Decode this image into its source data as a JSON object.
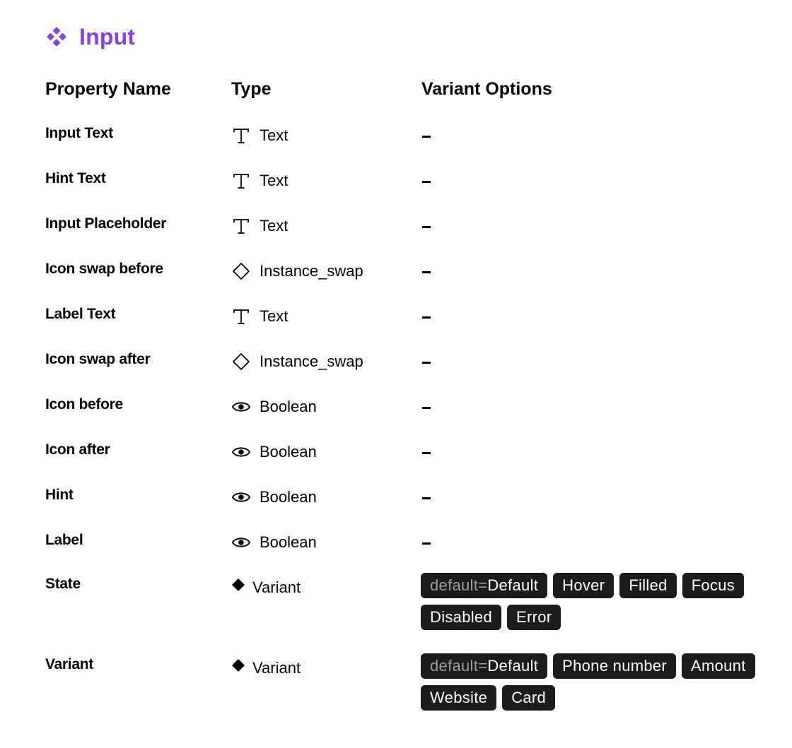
{
  "component": {
    "title": "Input",
    "icon": "component-icon",
    "accent_color": "#8a3ee8"
  },
  "headers": {
    "property_name": "Property Name",
    "type": "Type",
    "variant_options": "Variant Options"
  },
  "properties": [
    {
      "name": "Input Text",
      "type": "Text",
      "type_icon": "text-icon",
      "options_placeholder": "-"
    },
    {
      "name": "Hint Text",
      "type": "Text",
      "type_icon": "text-icon",
      "options_placeholder": "-"
    },
    {
      "name": "Input Placeholder",
      "type": "Text",
      "type_icon": "text-icon",
      "options_placeholder": "-"
    },
    {
      "name": "Icon swap before",
      "type": "Instance_swap",
      "type_icon": "instance-swap-icon",
      "options_placeholder": "-"
    },
    {
      "name": "Label Text",
      "type": "Text",
      "type_icon": "text-icon",
      "options_placeholder": "-"
    },
    {
      "name": "Icon swap after",
      "type": "Instance_swap",
      "type_icon": "instance-swap-icon",
      "options_placeholder": "-"
    },
    {
      "name": "Icon before",
      "type": "Boolean",
      "type_icon": "eye-icon",
      "options_placeholder": "-"
    },
    {
      "name": "Icon after",
      "type": "Boolean",
      "type_icon": "eye-icon",
      "options_placeholder": "-"
    },
    {
      "name": "Hint",
      "type": "Boolean",
      "type_icon": "eye-icon",
      "options_placeholder": "-"
    },
    {
      "name": "Label",
      "type": "Boolean",
      "type_icon": "eye-icon",
      "options_placeholder": "-"
    },
    {
      "name": "State",
      "type": "Variant",
      "type_icon": "variant-icon",
      "default_prefix": "default=",
      "options": [
        "Default",
        "Hover",
        "Filled",
        "Focus",
        "Disabled",
        "Error"
      ]
    },
    {
      "name": "Variant",
      "type": "Variant",
      "type_icon": "variant-icon",
      "default_prefix": "default=",
      "options": [
        "Default",
        "Phone number",
        "Amount",
        "Website",
        "Card"
      ]
    }
  ]
}
